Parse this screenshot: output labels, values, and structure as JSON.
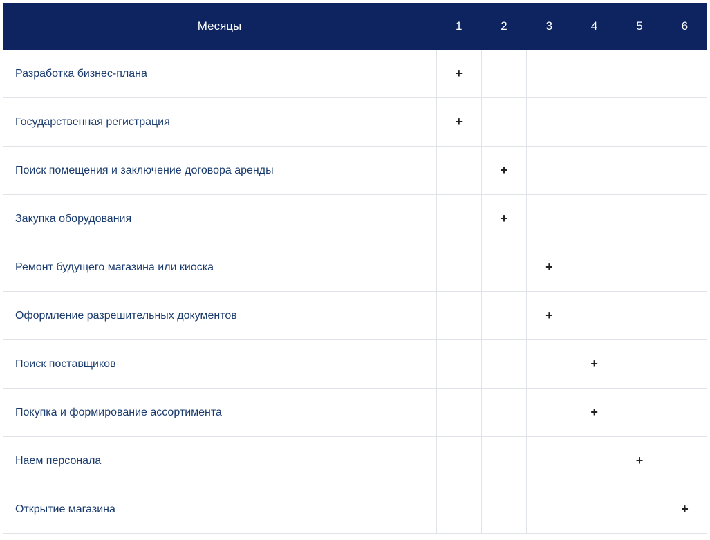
{
  "chart_data": {
    "type": "table",
    "title": "",
    "header_label": "Месяцы",
    "months": [
      "1",
      "2",
      "3",
      "4",
      "5",
      "6"
    ],
    "mark": "+",
    "rows": [
      {
        "label": "Разработка бизнес-плана",
        "marks": [
          true,
          false,
          false,
          false,
          false,
          false
        ]
      },
      {
        "label": "Государственная регистрация",
        "marks": [
          true,
          false,
          false,
          false,
          false,
          false
        ]
      },
      {
        "label": "Поиск помещения и заключение договора аренды",
        "marks": [
          false,
          true,
          false,
          false,
          false,
          false
        ]
      },
      {
        "label": "Закупка оборудования",
        "marks": [
          false,
          true,
          false,
          false,
          false,
          false
        ]
      },
      {
        "label": "Ремонт будущего магазина или киоска",
        "marks": [
          false,
          false,
          true,
          false,
          false,
          false
        ]
      },
      {
        "label": "Оформление разрешительных документов",
        "marks": [
          false,
          false,
          true,
          false,
          false,
          false
        ]
      },
      {
        "label": "Поиск поставщиков",
        "marks": [
          false,
          false,
          false,
          true,
          false,
          false
        ]
      },
      {
        "label": "Покупка и формирование ассортимента",
        "marks": [
          false,
          false,
          false,
          true,
          false,
          false
        ]
      },
      {
        "label": "Наем персонала",
        "marks": [
          false,
          false,
          false,
          false,
          true,
          false
        ]
      },
      {
        "label": "Открытие магазина",
        "marks": [
          false,
          false,
          false,
          false,
          false,
          true
        ]
      }
    ]
  }
}
